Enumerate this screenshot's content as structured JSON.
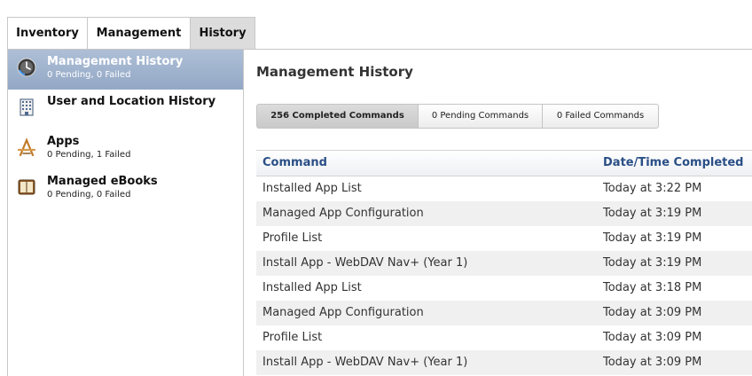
{
  "tabs": [
    "Inventory",
    "Management",
    "History"
  ],
  "sidebar": [
    {
      "title": "Management History",
      "subtitle": "0 Pending, 0 Failed",
      "icon": "management-history-icon"
    },
    {
      "title": "User and Location History",
      "subtitle": "",
      "icon": "building-icon"
    },
    {
      "title": "Apps",
      "subtitle": "0 Pending, 1 Failed",
      "icon": "app-store-icon"
    },
    {
      "title": "Managed eBooks",
      "subtitle": "0 Pending, 0 Failed",
      "icon": "book-icon"
    }
  ],
  "main": {
    "title": "Management History",
    "filters": [
      "256 Completed Commands",
      "0 Pending Commands",
      "0 Failed Commands"
    ],
    "columns": [
      "Command",
      "Date/Time Completed"
    ],
    "rows": [
      [
        "Installed App List",
        "Today at 3:22 PM"
      ],
      [
        "Managed App Configuration",
        "Today at 3:19 PM"
      ],
      [
        "Profile List",
        "Today at 3:19 PM"
      ],
      [
        "Install App - WebDAV Nav+ (Year 1)",
        "Today at 3:19 PM"
      ],
      [
        "Installed App List",
        "Today at 3:18 PM"
      ],
      [
        "Managed App Configuration",
        "Today at 3:09 PM"
      ],
      [
        "Profile List",
        "Today at 3:09 PM"
      ],
      [
        "Install App - WebDAV Nav+ (Year 1)",
        "Today at 3:09 PM"
      ]
    ]
  },
  "colors": {
    "accent": "#2a4f86",
    "active_item": "#9fb2cd"
  }
}
